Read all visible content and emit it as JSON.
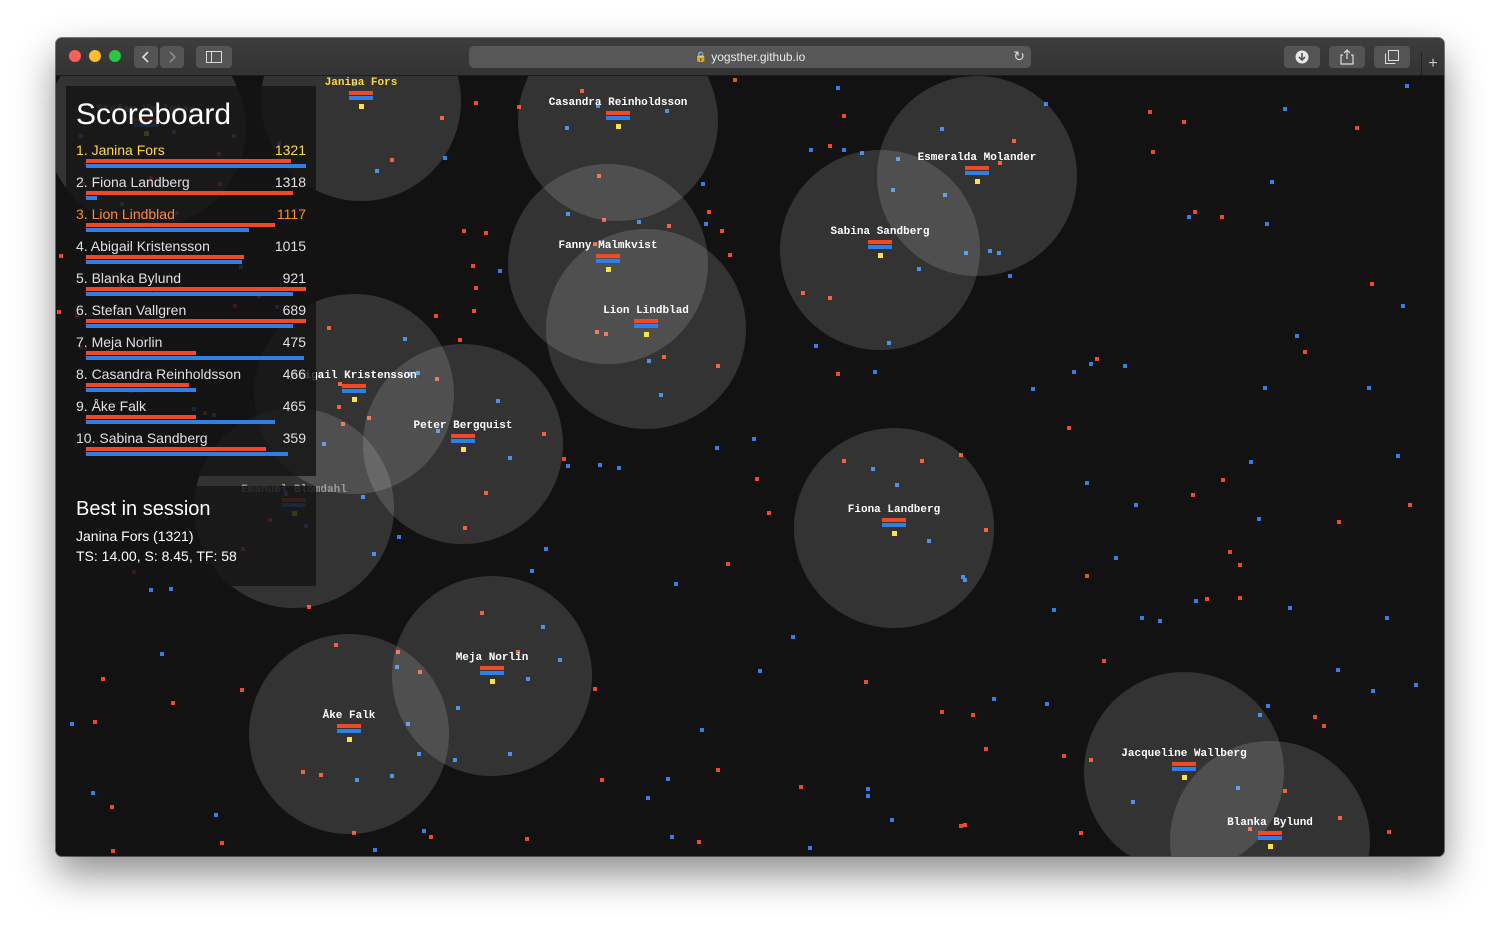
{
  "browser": {
    "url": "yogsther.github.io",
    "colors": {
      "close": "#ff5f57",
      "minimize": "#febc2e",
      "zoom": "#28c840"
    },
    "icons": [
      "back-arrow-icon",
      "forward-arrow-icon",
      "sidebar-icon",
      "lock-icon",
      "reload-icon",
      "download-icon",
      "share-icon",
      "tabs-icon",
      "plus-icon"
    ]
  },
  "scoreboard": {
    "title": "Scoreboard",
    "colors": {
      "first": "#ffd83a",
      "third": "#ff8b2b",
      "default": "#e0e0e0",
      "bar_red": "#ef4a25",
      "bar_blue": "#2f7fe8"
    },
    "entries": [
      {
        "label": "1. Janina Fors",
        "score": "1321",
        "red": 0.93,
        "blue": 1.0
      },
      {
        "label": "2. Fiona Landberg",
        "score": "1318",
        "red": 0.94,
        "blue": 0.05
      },
      {
        "label": "3. Lion Lindblad",
        "score": "1117",
        "red": 0.86,
        "blue": 0.74
      },
      {
        "label": "4. Abigail Kristensson",
        "score": "1015",
        "red": 0.72,
        "blue": 0.71
      },
      {
        "label": "5. Blanka Bylund",
        "score": "921",
        "red": 1.0,
        "blue": 0.94
      },
      {
        "label": "6. Stefan Vallgren",
        "score": "689",
        "red": 1.0,
        "blue": 0.94
      },
      {
        "label": "7. Meja Norlin",
        "score": "475",
        "red": 0.5,
        "blue": 0.99
      },
      {
        "label": "8. Casandra Reinholdsson",
        "score": "466",
        "red": 0.47,
        "blue": 0.5
      },
      {
        "label": "9. Åke Falk",
        "score": "465",
        "red": 0.5,
        "blue": 0.86
      },
      {
        "label": "10. Sabina Sandberg",
        "score": "359",
        "red": 0.82,
        "blue": 0.92
      }
    ]
  },
  "session": {
    "title": "Best in session",
    "line1": "Janina Fors (1321)",
    "line2": "TS: 14.00, S: 8.45, TF: 58"
  },
  "players": [
    {
      "name": "Janina Fors",
      "highlight": true
    },
    {
      "name": "Casandra Reinholdsson"
    },
    {
      "name": "Esmeralda Molander"
    },
    {
      "name": "Sabina Sandberg"
    },
    {
      "name": "Fanny Malmkvist"
    },
    {
      "name": "Lion Lindblad"
    },
    {
      "name": "Abigail Kristensson"
    },
    {
      "name": "Peter Bergquist"
    },
    {
      "name": "Emanuel Blomdahl",
      "dim": true
    },
    {
      "name": "Stefan Vallgren",
      "dim": true
    },
    {
      "name": "Fiona Landberg"
    },
    {
      "name": "Meja Norlin"
    },
    {
      "name": "Åke Falk"
    },
    {
      "name": "Jacqueline Wallberg"
    },
    {
      "name": "Blanka Bylund"
    }
  ]
}
